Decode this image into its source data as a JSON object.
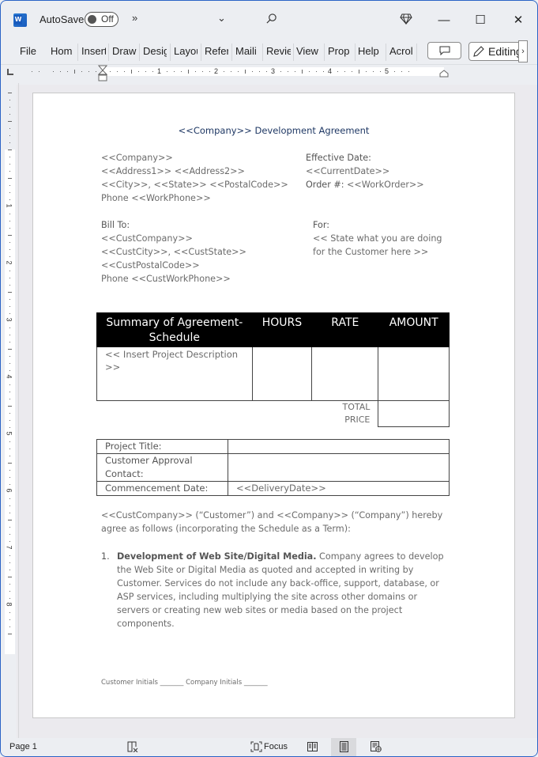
{
  "app": {
    "autosave_label": "AutoSave",
    "autosave_state": "Off",
    "more_commands": "»",
    "window_controls": {
      "minimize": "—",
      "maximize": "☐",
      "close": "✕"
    }
  },
  "ribbon": {
    "tabs": [
      "File",
      "Home",
      "Insert",
      "Draw",
      "Design",
      "Layout",
      "References",
      "Mailings",
      "Review",
      "View",
      "Properties",
      "Help",
      "Acrobat"
    ],
    "tabs_visible": [
      "File",
      "Hom",
      "Insert",
      "Draw",
      "Desig",
      "Layou",
      "Refer",
      "Maili",
      "Revie",
      "View",
      "Prop",
      "Help",
      "Acrol"
    ],
    "editing_label": "Editing",
    "scroll_right": "›"
  },
  "ruler": {
    "horizontal_numbers": [
      "1",
      "2",
      "3",
      "4",
      "5"
    ],
    "vertical_numbers": [
      "1",
      "2",
      "3",
      "4",
      "5",
      "6",
      "7",
      "8"
    ]
  },
  "document": {
    "title": "<<Company>> Development Agreement",
    "company_block": [
      "<<Company>>",
      "<<Address1>> <<Address2>>",
      "<<City>>, <<State>> <<PostalCode>>",
      "Phone <<WorkPhone>>"
    ],
    "effective_date_label": "Effective Date:",
    "current_date": "<<CurrentDate>>",
    "order_label": "Order #:",
    "order_value": " <<WorkOrder>>",
    "bill_to_label": "Bill To:",
    "bill_to_block": [
      "<<CustCompany>>",
      "<<CustCity>>, <<CustState>>",
      "<<CustPostalCode>>",
      "Phone <<CustWorkPhone>>"
    ],
    "for_label": "For:",
    "for_block": [
      "<<  State what you are doing",
      "for the Customer here >>"
    ],
    "summary_table": {
      "headers": [
        "Summary of Agreement-Schedule",
        "HOURS",
        "RATE",
        "AMOUNT"
      ],
      "row": [
        "<< Insert Project Description >>",
        "",
        "",
        ""
      ],
      "total_label_line1": "TOTAL",
      "total_label_line2": "PRICE",
      "total_value": ""
    },
    "info_table": [
      {
        "label": "Project Title:",
        "value": ""
      },
      {
        "label": "Customer Approval Contact:",
        "value": ""
      },
      {
        "label": "Commencement Date:",
        "value": "<<DeliveryDate>>"
      }
    ],
    "intro_paragraph": "<<CustCompany>> (“Customer”) and <<Company>> (“Company”) hereby agree as follows (incorporating the Schedule as a Term):",
    "list_items": [
      {
        "number": "1.",
        "bold": "Development of Web Site/Digital Media.",
        "text": " Company agrees to develop the Web Site or Digital Media as quoted and accepted in writing by Customer. Services do not include any back-office, support, database, or ASP services, including multiplying the site across other domains or servers or creating new web sites or media based on the project components."
      }
    ],
    "footer_initials": "Customer Initials  _______ Company Initials _______"
  },
  "status_bar": {
    "page": "Page 1",
    "focus_label": "Focus"
  }
}
